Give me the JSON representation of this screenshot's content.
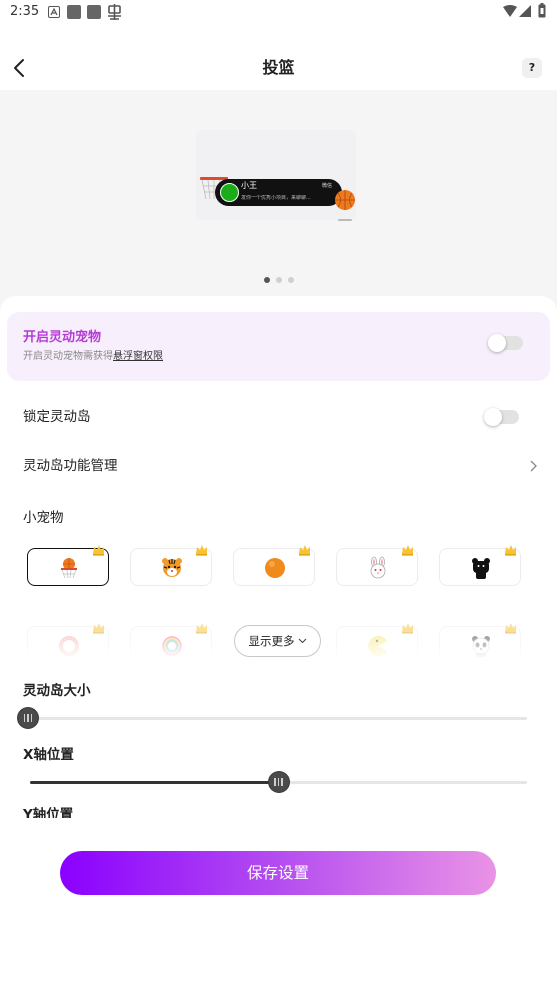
{
  "status_bar": {
    "time": "2:35"
  },
  "header": {
    "title": "投篮",
    "help": "?"
  },
  "preview": {
    "contact": "小王",
    "app": "微信",
    "message": "发你一个优秀小项目，来聊聊...",
    "page_count": 3,
    "active_page": 0
  },
  "pet_toggle": {
    "title": "开启灵动宠物",
    "subtitle": "开启灵动宠物需获得",
    "permission_link": "悬浮窗权限",
    "enabled": false
  },
  "lock_island": {
    "label": "锁定灵动岛",
    "enabled": false
  },
  "feature_manage": {
    "label": "灵动岛功能管理"
  },
  "pets": {
    "label": "小宠物",
    "selected": 0,
    "row1": [
      "basketball-hoop",
      "tiger",
      "orange-ball",
      "rabbit",
      "black-bear"
    ],
    "row2": [
      "donut",
      "rainbow-ring",
      "pacman",
      "panda"
    ],
    "badge_icon": "crown",
    "show_more": "显示更多"
  },
  "size": {
    "label": "灵动岛大小",
    "value": 0
  },
  "x_position": {
    "label": "X轴位置",
    "value": 50
  },
  "y_position": {
    "label": "Y轴位置"
  },
  "save_button": "保存设置",
  "colors": {
    "accent_purple": "#b43bd6",
    "save_gradient_start": "#8a00ff",
    "save_gradient_end": "#e993e6",
    "highlight_bg": "#f8effd"
  }
}
